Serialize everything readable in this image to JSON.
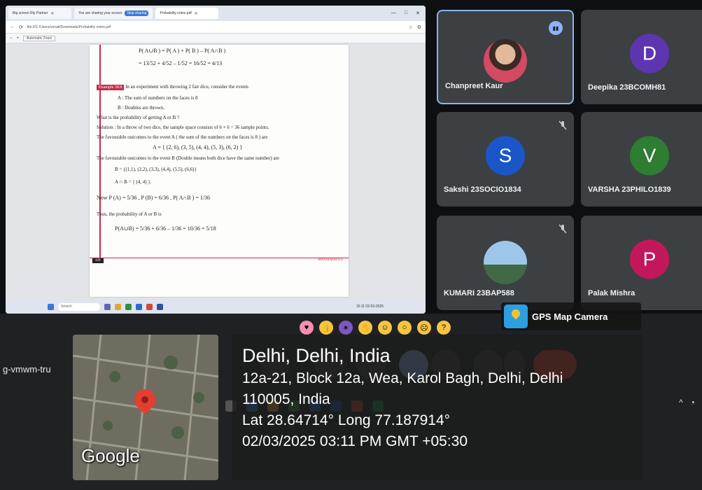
{
  "browser": {
    "tabs": [
      {
        "label": "Big screen Rty Partner",
        "badge": ""
      },
      {
        "label": "You are sharing your screen",
        "badge": "Stop sharing"
      },
      {
        "label": "Probability notes.pdf",
        "badge": ""
      }
    ],
    "url": "file:///C:/Users/unnati/Downloads/Probability notes.pdf",
    "zoom_label": "Automatic Zoom"
  },
  "pdf": {
    "lines": [
      "P( A∪B ) = P( A ) + P( B ) – P( A∩B )",
      "= 13/52 + 4/52 – 1/52 = 16/52 = 4/13",
      "In an experiment with throwing 2 fair dice, consider the events",
      "A : The sum of numbers on the faces is 8",
      "B : Doubles are thrown.",
      "What is the probability of getting A or B ?",
      "Solution : In a throw of two dice, the sample space consists of 6 × 6 = 36 sample points.",
      "The favourable outcomes to the event A ( the sum of the numbers on the faces is 8 ) are",
      "A = { (2, 6), (3, 5), (4, 4), (5, 3), (6, 2) }",
      "The favourable outcomes to the event B (Double means both dice have the same number) are",
      "B = {(1,1), (2,2), (3,3), (4,4), (5,5), (6,6)}",
      "A ∩ B = { (4, 4) }.",
      "Now  P (A) = 5/36 ,  P (B) = 6/36 ,      P( A∩B ) = 1/36",
      "Thus, the probability of A or B is",
      "P(A∪B) = 5/36 + 6/36 – 1/36 = 10/36 = 5/18"
    ],
    "example_label": "Example 39.8",
    "page_number": "420",
    "footer_mark": "MATHEMATICS"
  },
  "taskbar_small": {
    "search": "Search",
    "clock": "15:11 02-03-2025"
  },
  "participants": [
    {
      "name": "Chanpreet Kaur",
      "initial": "",
      "color": "#3c4043",
      "speaking": true,
      "muted": false
    },
    {
      "name": "Deepika 23BCOMH81",
      "initial": "D",
      "color": "#5e35b1",
      "speaking": false,
      "muted": false
    },
    {
      "name": "Sakshi 23SOCIO1834",
      "initial": "S",
      "color": "#1a56c8",
      "speaking": false,
      "muted": true
    },
    {
      "name": "VARSHA 23PHILO1839",
      "initial": "V",
      "color": "#2e7d32",
      "speaking": false,
      "muted": false
    },
    {
      "name": "KUMARI 23BAP588",
      "initial": "",
      "color": "#3c4043",
      "speaking": false,
      "muted": true
    },
    {
      "name": "Palak Mishra",
      "initial": "P",
      "color": "#c2185b",
      "speaking": false,
      "muted": false
    }
  ],
  "meet": {
    "code": "g-vmwm-tru"
  },
  "gps": {
    "brand": "GPS Map Camera",
    "map_label": "Google",
    "city": "Delhi, Delhi, India",
    "address_line1": "12a-21, Block 12a, Wea, Karol Bagh, Delhi, Delhi",
    "address_line2": "110005, India",
    "coords": "Lat 28.64714° Long 77.187914°",
    "datetime": "02/03/2025 03:11 PM GMT +05:30"
  },
  "colors": {
    "speaking": "#8ab4f8",
    "end_call": "#ea4335",
    "tile_bg": "#3c4043"
  }
}
